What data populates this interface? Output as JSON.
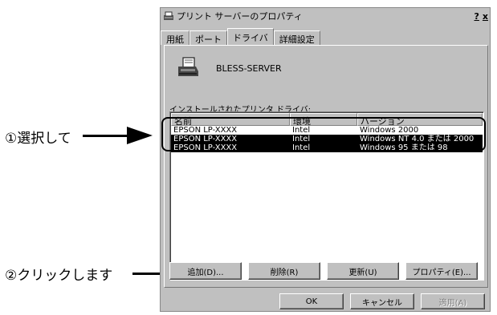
{
  "callouts": {
    "select": "①選択して",
    "click": "②クリックします"
  },
  "dialog": {
    "title": "プリント サーバーのプロパティ",
    "help_button": "?",
    "close_button": "x",
    "tabs": [
      "用紙",
      "ポート",
      "ドライバ",
      "詳細設定"
    ],
    "active_tab": "ドライバ",
    "server_name": "BLESS-SERVER",
    "drivers_label": "インストールされたプリンタ ドライバ:",
    "columns": [
      "名前",
      "環境",
      "バージョン"
    ],
    "rows": [
      {
        "name": "EPSON LP-XXXX",
        "env": "Intel",
        "version": "Windows 2000",
        "selected": false
      },
      {
        "name": "EPSON LP-XXXX",
        "env": "Intel",
        "version": "Windows NT 4.0 または 2000",
        "selected": true
      },
      {
        "name": "EPSON LP-XXXX",
        "env": "Intel",
        "version": "Windows 95 または 98",
        "selected": true
      }
    ],
    "buttons": {
      "add": "追加(D)...",
      "remove": "削除(R)",
      "update": "更新(U)",
      "properties": "プロパティ(E)..."
    },
    "footer": {
      "ok": "OK",
      "cancel": "キャンセル",
      "apply": "適用(A)"
    }
  },
  "icons": {
    "title": "printer-title-icon",
    "server": "printer-icon"
  }
}
